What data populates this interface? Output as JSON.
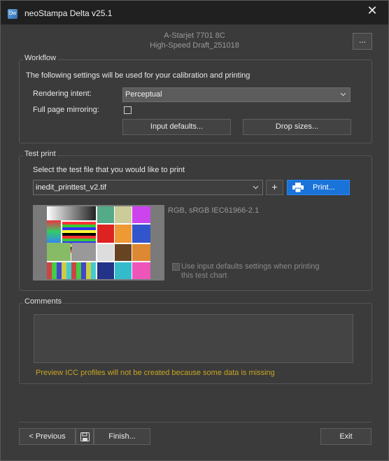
{
  "window": {
    "title": "neoStampa Delta  v25.1",
    "icon_label": "Dw",
    "close_symbol": "✕"
  },
  "printer": {
    "model": "A-Starjet 7701 8C",
    "mode": "High-Speed Draft_251018",
    "more_label": "..."
  },
  "workflow": {
    "title": "Workflow",
    "description": "The following settings will be used for your calibration and printing",
    "rendering_intent_label": "Rendering intent:",
    "rendering_intent_value": "Perceptual",
    "mirroring_label": "Full page mirroring:",
    "mirroring_checked": false,
    "input_defaults_label": "Input defaults...",
    "drop_sizes_label": "Drop sizes..."
  },
  "test_print": {
    "title": "Test print",
    "instruction": "Select the test file that you would like to print",
    "file_value": "inedit_printtest_v2.tif",
    "add_label": "+",
    "print_label": "Print...",
    "color_info": "RGB, sRGB IEC61966-2.1",
    "use_defaults_label_line1": "Use input defaults settings when printing",
    "use_defaults_label_line2": "this test chart",
    "use_defaults_checked": false
  },
  "comments": {
    "title": "Comments",
    "text": "",
    "warning": "Preview ICC profiles will not be created because some data is missing"
  },
  "footer": {
    "previous_label": "< Previous",
    "finish_label": "Finish...",
    "exit_label": "Exit"
  },
  "colors": {
    "accent": "#1a73d9",
    "warning": "#c8a520",
    "background": "#3b3b3b",
    "titlebar": "#202020"
  },
  "icons": {
    "app": "app-logo-icon",
    "close": "close-icon",
    "dropdown": "chevron-down-icon",
    "printer": "printer-icon",
    "save": "floppy-disk-icon"
  }
}
